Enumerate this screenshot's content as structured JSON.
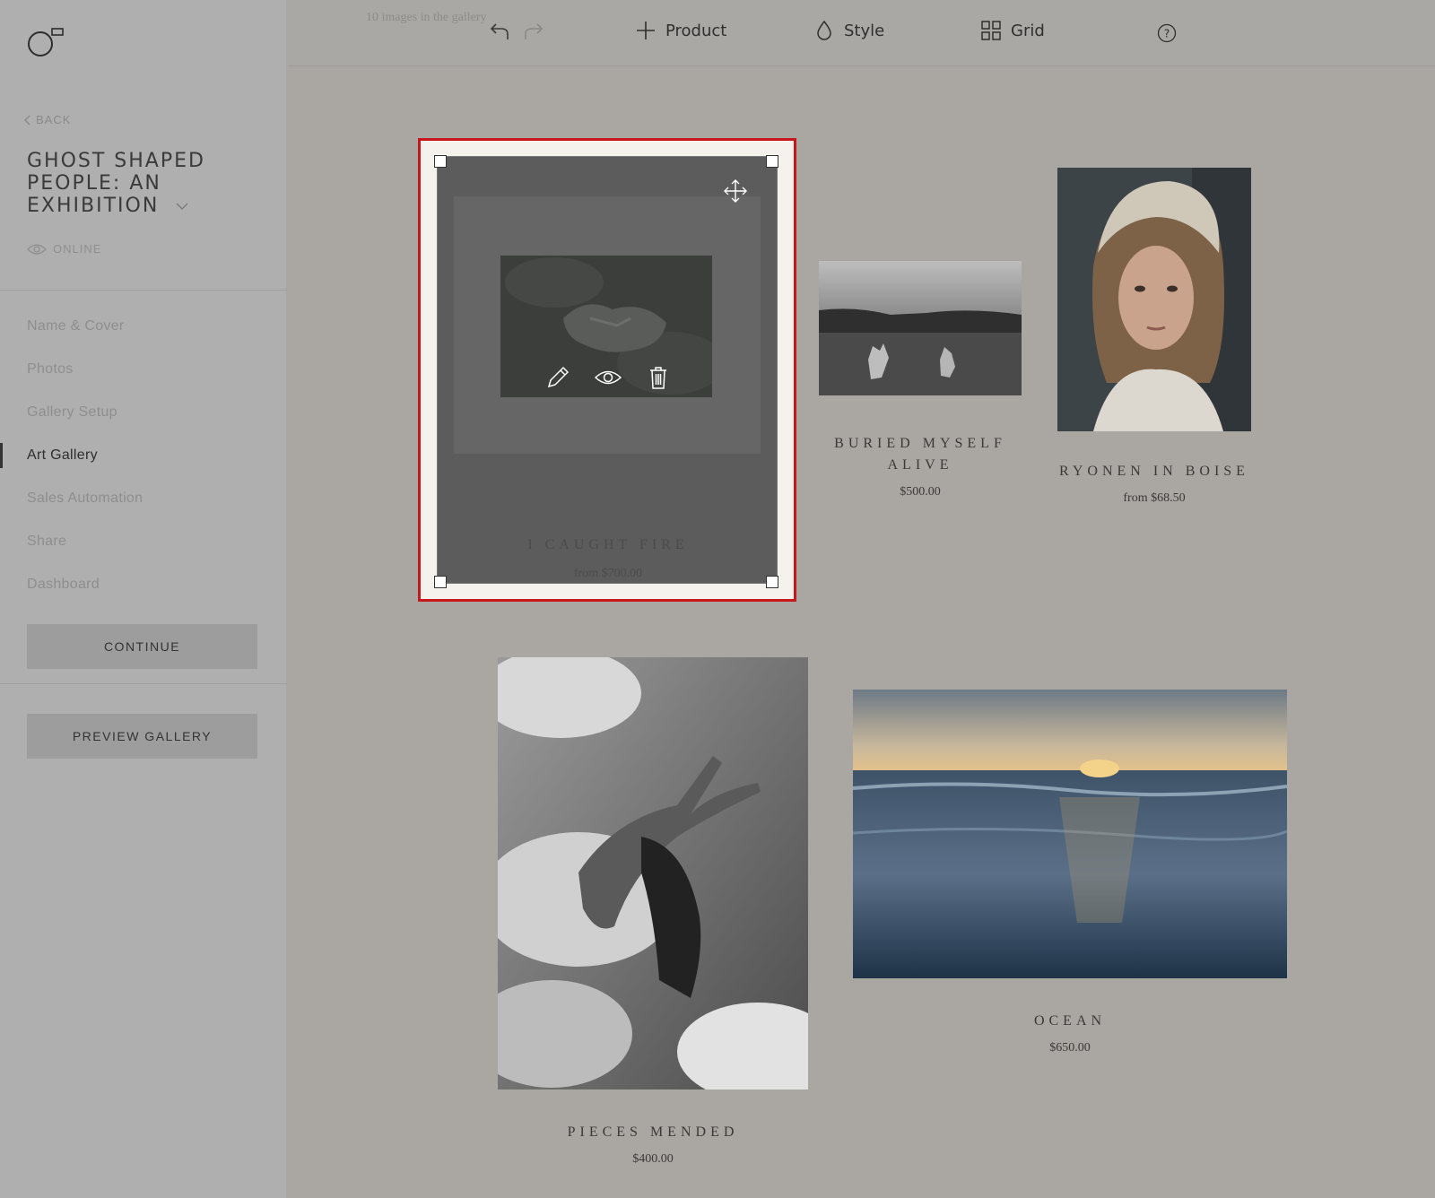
{
  "sidebar": {
    "back_label": "BACK",
    "gallery_title": "GHOST SHAPED PEOPLE: AN EXHIBITION",
    "status_label": "ONLINE",
    "nav": [
      {
        "label": "Name & Cover",
        "active": false
      },
      {
        "label": "Photos",
        "active": false
      },
      {
        "label": "Gallery Setup",
        "active": false
      },
      {
        "label": "Art Gallery",
        "active": true
      },
      {
        "label": "Sales Automation",
        "active": false
      },
      {
        "label": "Share",
        "active": false
      },
      {
        "label": "Dashboard",
        "active": false
      }
    ],
    "continue_label": "CONTINUE",
    "preview_label": "PREVIEW GALLERY"
  },
  "toolbar": {
    "image_count": "10 images in the gallery",
    "product_label": "Product",
    "style_label": "Style",
    "grid_label": "Grid"
  },
  "products": [
    {
      "title": "I CAUGHT FIRE",
      "price": "from $700.00",
      "selected": true
    },
    {
      "title": "BURIED MYSELF ALIVE",
      "price": "$500.00"
    },
    {
      "title": "RYONEN IN BOISE",
      "price": "from $68.50"
    },
    {
      "title": "PIECES MENDED",
      "price": "$400.00"
    },
    {
      "title": "OCEAN",
      "price": "$650.00"
    }
  ],
  "colors": {
    "selection": "#c8161d",
    "sidebar_bg": "#afafaf",
    "canvas_bg": "#aaa7a2"
  },
  "icons": [
    "logo-icon",
    "chevron-left-icon",
    "chevron-down-icon",
    "eye-icon",
    "undo-icon",
    "redo-icon",
    "plus-icon",
    "droplet-icon",
    "grid-icon",
    "help-icon",
    "pencil-icon",
    "preview-icon",
    "trash-icon",
    "move-icon"
  ]
}
